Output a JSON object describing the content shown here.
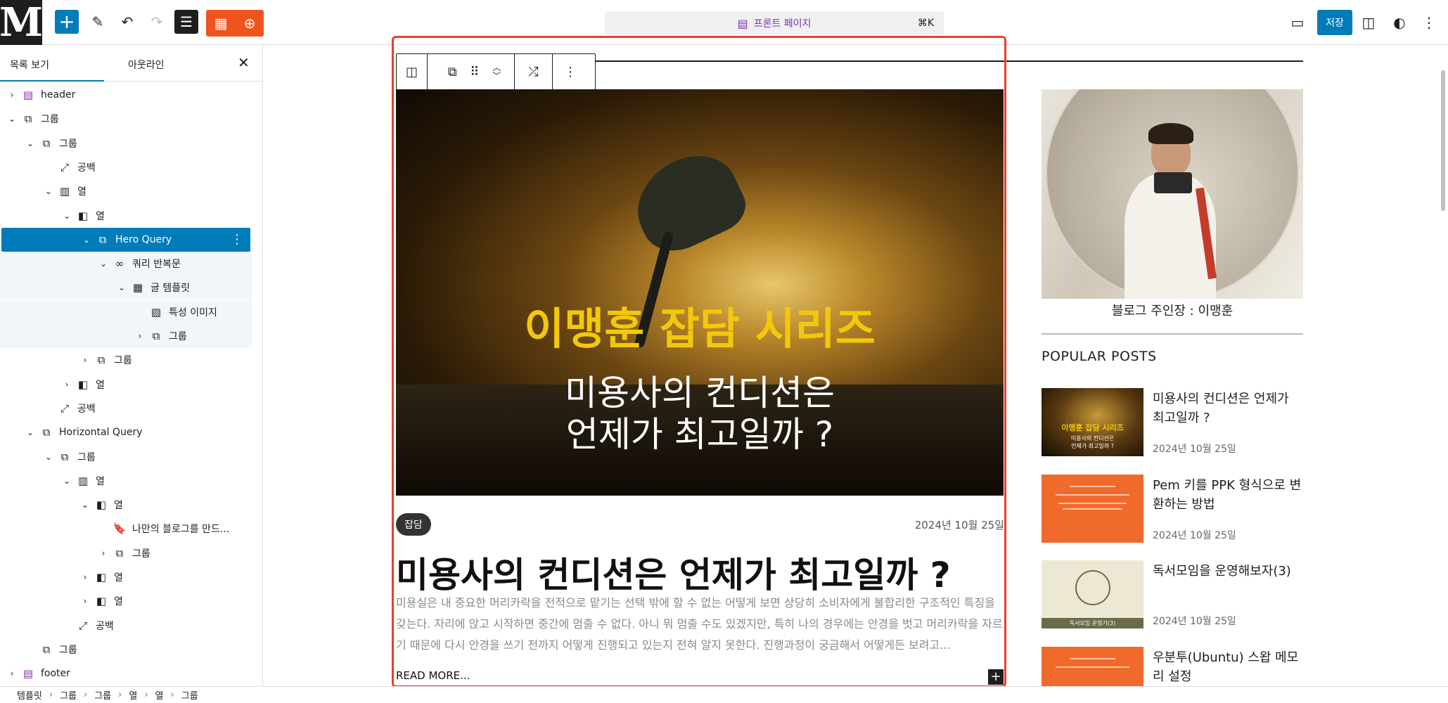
{
  "topbar": {
    "logo_letter": "M",
    "command_label": "프론트 페이지",
    "command_shortcut": "⌘K",
    "save_label": "저장",
    "colors": {
      "accent": "#007cba",
      "orange": "#f0541e",
      "purple": "#7b2fb8"
    }
  },
  "sidebar": {
    "tabs": [
      "목록 보기",
      "아웃라인"
    ],
    "rows": [
      {
        "label": "header",
        "depth": 0,
        "chev": "right",
        "icon": "template-part-icon"
      },
      {
        "label": "그룹",
        "depth": 0,
        "chev": "down",
        "icon": "group-icon"
      },
      {
        "label": "그룹",
        "depth": 1,
        "chev": "down",
        "icon": "group-icon"
      },
      {
        "label": "공백",
        "depth": 2,
        "chev": "",
        "icon": "spacer-icon"
      },
      {
        "label": "열",
        "depth": 2,
        "chev": "down",
        "icon": "columns-icon"
      },
      {
        "label": "열",
        "depth": 3,
        "chev": "down",
        "icon": "column-icon"
      },
      {
        "label": "Hero Query",
        "depth": 4,
        "chev": "down",
        "icon": "query-icon",
        "selected": true
      },
      {
        "label": "쿼리 반복문",
        "depth": 5,
        "chev": "down",
        "icon": "loop-icon"
      },
      {
        "label": "글 템플릿",
        "depth": 6,
        "chev": "down",
        "icon": "post-template-icon"
      },
      {
        "label": "특성 이미지",
        "depth": 7,
        "chev": "",
        "icon": "featured-image-icon"
      },
      {
        "label": "그룹",
        "depth": 7,
        "chev": "right",
        "icon": "group-icon"
      },
      {
        "label": "그룹",
        "depth": 4,
        "chev": "right",
        "icon": "group-icon"
      },
      {
        "label": "열",
        "depth": 3,
        "chev": "right",
        "icon": "column-icon"
      },
      {
        "label": "공백",
        "depth": 2,
        "chev": "",
        "icon": "spacer-icon"
      },
      {
        "label": "Horizontal Query",
        "depth": 1,
        "chev": "down",
        "icon": "query-icon"
      },
      {
        "label": "그룹",
        "depth": 2,
        "chev": "down",
        "icon": "group-icon"
      },
      {
        "label": "열",
        "depth": 3,
        "chev": "down",
        "icon": "columns-icon"
      },
      {
        "label": "열",
        "depth": 4,
        "chev": "down",
        "icon": "column-icon"
      },
      {
        "label": "나만의 블로그를 만드...",
        "depth": 5,
        "chev": "",
        "icon": "bookmark-icon"
      },
      {
        "label": "그룹",
        "depth": 5,
        "chev": "right",
        "icon": "group-icon"
      },
      {
        "label": "열",
        "depth": 4,
        "chev": "right",
        "icon": "column-icon"
      },
      {
        "label": "열",
        "depth": 4,
        "chev": "right",
        "icon": "column-icon"
      },
      {
        "label": "공백",
        "depth": 3,
        "chev": "",
        "icon": "spacer-icon"
      },
      {
        "label": "그룹",
        "depth": 1,
        "chev": "",
        "icon": "group-icon"
      },
      {
        "label": "footer",
        "depth": 0,
        "chev": "right",
        "icon": "template-part-icon"
      }
    ]
  },
  "breadcrumbs": [
    "템플릿",
    "그룹",
    "그룹",
    "열",
    "열",
    "그룹"
  ],
  "hero": {
    "title": "이맹훈 잡담 시리즈",
    "subtitle_line1": "미용사의 컨디션은",
    "subtitle_line2": "언제가 최고일까 ?"
  },
  "post": {
    "category": "잡담",
    "date": "2024년 10월 25일",
    "title": "미용사의 컨디션은 언제가 최고일까 ?",
    "excerpt": "미용실은 내 중요한 머리카락을 전적으로 맡기는 선택 밖에 할 수 없는 어떻게 보면 상당히 소비자에게 불합리한 구조적인 특징을 갖는다. 자리에 앉고 시작하면 중간에 멈출 수 없다. 아니 뭐 멈출 수도 있겠지만, 특히 나의 경우에는 안경을 벗고 머리카락을 자르기 때문에 다시 안경을 쓰기 전까지 어떻게 진행되고 있는지 전혀 알지 못한다. 진행과정이 궁금해서 어떻게든 보려고...",
    "read_more": "READ MORE..."
  },
  "sidebar_widget": {
    "profile_caption": "블로그 주인장 : 이맹훈",
    "popular_heading": "POPULAR POSTS",
    "posts": [
      {
        "title": "미용사의 컨디션은 언제가 최고일까 ?",
        "date": "2024년 10월 25일",
        "thumb_t1": "이맹훈 잡담 시리즈",
        "thumb_t2a": "미용사의 컨디션은",
        "thumb_t2b": "언제가 최고일까 ?"
      },
      {
        "title": "Pem 키를 PPK 형식으로 변환하는 방법",
        "date": "2024년 10월 25일"
      },
      {
        "title": "독서모임을 운영해보자(3)",
        "date": "2024년 10월 25일",
        "thumb_band": "독서모임 운영기(3)"
      },
      {
        "title": "우분투(Ubuntu) 스왑 메모리 설정",
        "date": ""
      }
    ]
  }
}
